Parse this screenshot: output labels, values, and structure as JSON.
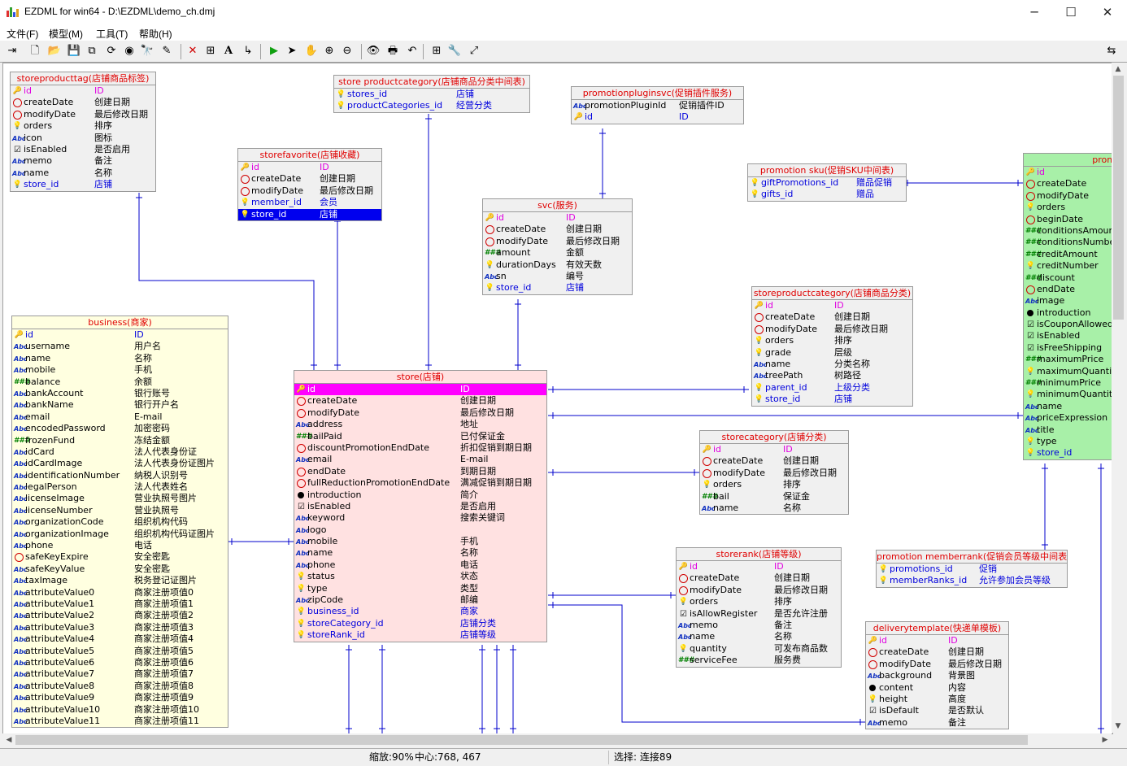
{
  "window": {
    "title": "EZDML for win64 - D:\\EZDML\\demo_ch.dmj",
    "minimize_glyph": "─",
    "maximize_glyph": "☐",
    "close_glyph": "✕"
  },
  "menu": {
    "items": [
      "文件(F)",
      "模型(M)",
      "工具(T)",
      "帮助(H)"
    ]
  },
  "toolbar": {
    "icons": [
      "export-icon",
      "new-icon",
      "open-icon",
      "save-icon",
      "copy-icon",
      "refresh-icon",
      "globe-icon",
      "find-icon",
      "highlight-icon",
      "delete-icon",
      "table-icon",
      "text-icon",
      "link-icon",
      "run-icon",
      "pointer-icon",
      "hand-icon",
      "zoom-in-icon",
      "zoom-out-icon",
      "view-icon",
      "print-icon",
      "undo-icon",
      "add-table-icon",
      "properties-icon",
      "fit-icon",
      "split-view-icon"
    ],
    "glyphs": [
      "⇥",
      "🗋",
      "📂",
      "💾",
      "⧉",
      "⟳",
      "◉",
      "🔭",
      "✎",
      "✕",
      "⊞",
      "A",
      "↳",
      "▶",
      "➤",
      "✋",
      "⊕",
      "⊖",
      "👁",
      "🖶",
      "↶",
      "⊞",
      "🔧",
      "⤢",
      "⇆"
    ]
  },
  "colors": {
    "pk": "#e000e0",
    "fk": "#0000dd",
    "table_header": "#e00000",
    "store_table": "#ffe1e1",
    "business_table": "#ffffe0",
    "promotion_table": "#a8f0a8",
    "selection": "#0000ee",
    "link_line": "#0000cc"
  },
  "tables": [
    {
      "id": "storeproducttag",
      "title": "storeproducttag(店铺商品标签)",
      "fields": [
        {
          "name": "id",
          "cn": "ID",
          "icon": "pk",
          "kind": "pk"
        },
        {
          "name": "createDate",
          "cn": "创建日期",
          "icon": "date"
        },
        {
          "name": "modifyDate",
          "cn": "最后修改日期",
          "icon": "date"
        },
        {
          "name": "orders",
          "cn": "排序",
          "icon": "int"
        },
        {
          "name": "icon",
          "cn": "图标",
          "icon": "str"
        },
        {
          "name": "isEnabled",
          "cn": "是否启用",
          "icon": "bool"
        },
        {
          "name": "memo",
          "cn": "备注",
          "icon": "str"
        },
        {
          "name": "name",
          "cn": "名称",
          "icon": "str"
        },
        {
          "name": "store_id",
          "cn": "店铺",
          "icon": "fk",
          "kind": "fk"
        }
      ]
    },
    {
      "id": "store_productcategory",
      "title": "store productcategory(店铺商品分类中间表)",
      "fields": [
        {
          "name": "stores_id",
          "cn": "店铺",
          "icon": "fk",
          "kind": "fk"
        },
        {
          "name": "productCategories_id",
          "cn": "经营分类",
          "icon": "fk",
          "kind": "fk"
        }
      ]
    },
    {
      "id": "promotionpluginsvc",
      "title": "promotionpluginsvc(促销插件服务)",
      "fields": [
        {
          "name": "promotionPluginId",
          "cn": "促销插件ID",
          "icon": "str"
        },
        {
          "name": "id",
          "cn": "ID",
          "icon": "pk",
          "kind": "fk"
        }
      ]
    },
    {
      "id": "promotion_sku",
      "title": "promotion sku(促销SKU中间表)",
      "fields": [
        {
          "name": "giftPromotions_id",
          "cn": "赠品促销",
          "icon": "fk",
          "kind": "fk"
        },
        {
          "name": "gifts_id",
          "cn": "赠品",
          "icon": "fk",
          "kind": "fk"
        }
      ]
    },
    {
      "id": "promotion",
      "title": "prom",
      "fields": [
        {
          "name": "id",
          "cn": "",
          "icon": "pk",
          "kind": "pk"
        },
        {
          "name": "createDate",
          "cn": "",
          "icon": "date"
        },
        {
          "name": "modifyDate",
          "cn": "",
          "icon": "date"
        },
        {
          "name": "orders",
          "cn": "",
          "icon": "int"
        },
        {
          "name": "beginDate",
          "cn": "",
          "icon": "date"
        },
        {
          "name": "conditionsAmount",
          "cn": "",
          "icon": "num"
        },
        {
          "name": "conditionsNumber",
          "cn": "",
          "icon": "num"
        },
        {
          "name": "creditAmount",
          "cn": "",
          "icon": "num"
        },
        {
          "name": "creditNumber",
          "cn": "",
          "icon": "int"
        },
        {
          "name": "discount",
          "cn": "",
          "icon": "num"
        },
        {
          "name": "endDate",
          "cn": "",
          "icon": "date"
        },
        {
          "name": "image",
          "cn": "",
          "icon": "str"
        },
        {
          "name": "introduction",
          "cn": "",
          "icon": "blob"
        },
        {
          "name": "isCouponAllowed",
          "cn": "",
          "icon": "bool"
        },
        {
          "name": "isEnabled",
          "cn": "",
          "icon": "bool"
        },
        {
          "name": "isFreeShipping",
          "cn": "",
          "icon": "bool"
        },
        {
          "name": "maximumPrice",
          "cn": "",
          "icon": "num"
        },
        {
          "name": "maximumQuantity",
          "cn": "",
          "icon": "int"
        },
        {
          "name": "minimumPrice",
          "cn": "",
          "icon": "num"
        },
        {
          "name": "minimumQuantity",
          "cn": "",
          "icon": "int"
        },
        {
          "name": "name",
          "cn": "",
          "icon": "str"
        },
        {
          "name": "priceExpression",
          "cn": "",
          "icon": "str"
        },
        {
          "name": "title",
          "cn": "",
          "icon": "str"
        },
        {
          "name": "type",
          "cn": "",
          "icon": "int"
        },
        {
          "name": "store_id",
          "cn": "",
          "icon": "fk",
          "kind": "fk"
        }
      ]
    },
    {
      "id": "storefavorite",
      "title": "storefavorite(店铺收藏)",
      "fields": [
        {
          "name": "id",
          "cn": "ID",
          "icon": "pk",
          "kind": "pk"
        },
        {
          "name": "createDate",
          "cn": "创建日期",
          "icon": "date"
        },
        {
          "name": "modifyDate",
          "cn": "最后修改日期",
          "icon": "date"
        },
        {
          "name": "member_id",
          "cn": "会员",
          "icon": "fk",
          "kind": "fk"
        },
        {
          "name": "store_id",
          "cn": "店铺",
          "icon": "fk",
          "kind": "fk",
          "selected": true
        }
      ]
    },
    {
      "id": "svc",
      "title": "svc(服务)",
      "fields": [
        {
          "name": "id",
          "cn": "ID",
          "icon": "pk",
          "kind": "pk"
        },
        {
          "name": "createDate",
          "cn": "创建日期",
          "icon": "date"
        },
        {
          "name": "modifyDate",
          "cn": "最后修改日期",
          "icon": "date"
        },
        {
          "name": "amount",
          "cn": "金额",
          "icon": "num"
        },
        {
          "name": "durationDays",
          "cn": "有效天数",
          "icon": "int"
        },
        {
          "name": "sn",
          "cn": "编号",
          "icon": "str"
        },
        {
          "name": "store_id",
          "cn": "店铺",
          "icon": "fk",
          "kind": "fk"
        }
      ]
    },
    {
      "id": "storeproductcategory",
      "title": "storeproductcategory(店铺商品分类)",
      "fields": [
        {
          "name": "id",
          "cn": "ID",
          "icon": "pk",
          "kind": "pk"
        },
        {
          "name": "createDate",
          "cn": "创建日期",
          "icon": "date"
        },
        {
          "name": "modifyDate",
          "cn": "最后修改日期",
          "icon": "date"
        },
        {
          "name": "orders",
          "cn": "排序",
          "icon": "int"
        },
        {
          "name": "grade",
          "cn": "层级",
          "icon": "int"
        },
        {
          "name": "name",
          "cn": "分类名称",
          "icon": "str"
        },
        {
          "name": "treePath",
          "cn": "树路径",
          "icon": "str"
        },
        {
          "name": "parent_id",
          "cn": "上级分类",
          "icon": "fk",
          "kind": "fk"
        },
        {
          "name": "store_id",
          "cn": "店铺",
          "icon": "fk",
          "kind": "fk"
        }
      ]
    },
    {
      "id": "business",
      "title": "business(商家)",
      "fields": [
        {
          "name": "id",
          "cn": "ID",
          "icon": "pk",
          "kind": "fk"
        },
        {
          "name": "username",
          "cn": "用户名",
          "icon": "str"
        },
        {
          "name": "name",
          "cn": "名称",
          "icon": "str"
        },
        {
          "name": "mobile",
          "cn": "手机",
          "icon": "str"
        },
        {
          "name": "balance",
          "cn": "余额",
          "icon": "num"
        },
        {
          "name": "bankAccount",
          "cn": "银行账号",
          "icon": "str"
        },
        {
          "name": "bankName",
          "cn": "银行开户名",
          "icon": "str"
        },
        {
          "name": "email",
          "cn": "E-mail",
          "icon": "str"
        },
        {
          "name": "encodedPassword",
          "cn": "加密密码",
          "icon": "str"
        },
        {
          "name": "frozenFund",
          "cn": "冻结金额",
          "icon": "num"
        },
        {
          "name": "idCard",
          "cn": "法人代表身份证",
          "icon": "str"
        },
        {
          "name": "idCardImage",
          "cn": "法人代表身份证图片",
          "icon": "str"
        },
        {
          "name": "identificationNumber",
          "cn": "纳税人识别号",
          "icon": "str"
        },
        {
          "name": "legalPerson",
          "cn": "法人代表姓名",
          "icon": "str"
        },
        {
          "name": "licenseImage",
          "cn": "营业执照号图片",
          "icon": "str"
        },
        {
          "name": "licenseNumber",
          "cn": "营业执照号",
          "icon": "str"
        },
        {
          "name": "organizationCode",
          "cn": "组织机构代码",
          "icon": "str"
        },
        {
          "name": "organizationImage",
          "cn": "组织机构代码证图片",
          "icon": "str"
        },
        {
          "name": "phone",
          "cn": "电话",
          "icon": "str"
        },
        {
          "name": "safeKeyExpire",
          "cn": "安全密匙",
          "icon": "date"
        },
        {
          "name": "safeKeyValue",
          "cn": "安全密匙",
          "icon": "str"
        },
        {
          "name": "taxImage",
          "cn": "税务登记证图片",
          "icon": "str"
        },
        {
          "name": "attributeValue0",
          "cn": "商家注册项值0",
          "icon": "str"
        },
        {
          "name": "attributeValue1",
          "cn": "商家注册项值1",
          "icon": "str"
        },
        {
          "name": "attributeValue2",
          "cn": "商家注册项值2",
          "icon": "str"
        },
        {
          "name": "attributeValue3",
          "cn": "商家注册项值3",
          "icon": "str"
        },
        {
          "name": "attributeValue4",
          "cn": "商家注册项值4",
          "icon": "str"
        },
        {
          "name": "attributeValue5",
          "cn": "商家注册项值5",
          "icon": "str"
        },
        {
          "name": "attributeValue6",
          "cn": "商家注册项值6",
          "icon": "str"
        },
        {
          "name": "attributeValue7",
          "cn": "商家注册项值7",
          "icon": "str"
        },
        {
          "name": "attributeValue8",
          "cn": "商家注册项值8",
          "icon": "str"
        },
        {
          "name": "attributeValue9",
          "cn": "商家注册项值9",
          "icon": "str"
        },
        {
          "name": "attributeValue10",
          "cn": "商家注册项值10",
          "icon": "str"
        },
        {
          "name": "attributeValue11",
          "cn": "商家注册项值11",
          "icon": "str"
        }
      ]
    },
    {
      "id": "store",
      "title": "store(店铺)",
      "fields": [
        {
          "name": "id",
          "cn": "ID",
          "icon": "pk",
          "kind": "pk",
          "highlight": true
        },
        {
          "name": "createDate",
          "cn": "创建日期",
          "icon": "date"
        },
        {
          "name": "modifyDate",
          "cn": "最后修改日期",
          "icon": "date"
        },
        {
          "name": "address",
          "cn": "地址",
          "icon": "str"
        },
        {
          "name": "bailPaid",
          "cn": "已付保证金",
          "icon": "num"
        },
        {
          "name": "discountPromotionEndDate",
          "cn": "折扣促销到期日期",
          "icon": "date"
        },
        {
          "name": "email",
          "cn": "E-mail",
          "icon": "str"
        },
        {
          "name": "endDate",
          "cn": "到期日期",
          "icon": "date"
        },
        {
          "name": "fullReductionPromotionEndDate",
          "cn": "满减促销到期日期",
          "icon": "date"
        },
        {
          "name": "introduction",
          "cn": "简介",
          "icon": "blob"
        },
        {
          "name": "isEnabled",
          "cn": "是否启用",
          "icon": "bool"
        },
        {
          "name": "keyword",
          "cn": "搜索关键词",
          "icon": "str"
        },
        {
          "name": "logo",
          "cn": "",
          "icon": "str"
        },
        {
          "name": "mobile",
          "cn": "手机",
          "icon": "str"
        },
        {
          "name": "name",
          "cn": "名称",
          "icon": "str"
        },
        {
          "name": "phone",
          "cn": "电话",
          "icon": "str"
        },
        {
          "name": "status",
          "cn": "状态",
          "icon": "int"
        },
        {
          "name": "type",
          "cn": "类型",
          "icon": "int"
        },
        {
          "name": "zipCode",
          "cn": "邮编",
          "icon": "str"
        },
        {
          "name": "business_id",
          "cn": "商家",
          "icon": "fk",
          "kind": "fk"
        },
        {
          "name": "storeCategory_id",
          "cn": "店铺分类",
          "icon": "fk",
          "kind": "fk"
        },
        {
          "name": "storeRank_id",
          "cn": "店铺等级",
          "icon": "fk",
          "kind": "fk"
        }
      ]
    },
    {
      "id": "storecategory",
      "title": "storecategory(店铺分类)",
      "fields": [
        {
          "name": "id",
          "cn": "ID",
          "icon": "pk",
          "kind": "pk"
        },
        {
          "name": "createDate",
          "cn": "创建日期",
          "icon": "date"
        },
        {
          "name": "modifyDate",
          "cn": "最后修改日期",
          "icon": "date"
        },
        {
          "name": "orders",
          "cn": "排序",
          "icon": "int"
        },
        {
          "name": "bail",
          "cn": "保证金",
          "icon": "num"
        },
        {
          "name": "name",
          "cn": "名称",
          "icon": "str"
        }
      ]
    },
    {
      "id": "promotion_memberrank",
      "title": "promotion memberrank(促销会员等级中间表)",
      "fields": [
        {
          "name": "promotions_id",
          "cn": "促销",
          "icon": "fk",
          "kind": "fk"
        },
        {
          "name": "memberRanks_id",
          "cn": "允许参加会员等级",
          "icon": "fk",
          "kind": "fk"
        }
      ]
    },
    {
      "id": "storerank",
      "title": "storerank(店铺等级)",
      "fields": [
        {
          "name": "id",
          "cn": "ID",
          "icon": "pk",
          "kind": "pk"
        },
        {
          "name": "createDate",
          "cn": "创建日期",
          "icon": "date"
        },
        {
          "name": "modifyDate",
          "cn": "最后修改日期",
          "icon": "date"
        },
        {
          "name": "orders",
          "cn": "排序",
          "icon": "int"
        },
        {
          "name": "isAllowRegister",
          "cn": "是否允许注册",
          "icon": "bool"
        },
        {
          "name": "memo",
          "cn": "备注",
          "icon": "str"
        },
        {
          "name": "name",
          "cn": "名称",
          "icon": "str"
        },
        {
          "name": "quantity",
          "cn": "可发布商品数",
          "icon": "int"
        },
        {
          "name": "serviceFee",
          "cn": "服务费",
          "icon": "num"
        }
      ]
    },
    {
      "id": "deliverytemplate",
      "title": "deliverytemplate(快递单模板)",
      "fields": [
        {
          "name": "id",
          "cn": "ID",
          "icon": "pk",
          "kind": "pk"
        },
        {
          "name": "createDate",
          "cn": "创建日期",
          "icon": "date"
        },
        {
          "name": "modifyDate",
          "cn": "最后修改日期",
          "icon": "date"
        },
        {
          "name": "background",
          "cn": "背景图",
          "icon": "str"
        },
        {
          "name": "content",
          "cn": "内容",
          "icon": "blob"
        },
        {
          "name": "height",
          "cn": "高度",
          "icon": "int"
        },
        {
          "name": "isDefault",
          "cn": "是否默认",
          "icon": "bool"
        },
        {
          "name": "memo",
          "cn": "备注",
          "icon": "str"
        }
      ]
    }
  ],
  "status": {
    "zoom": "缩放:90%",
    "center": "中心:768, 467",
    "selection": "选择: 连接89"
  }
}
